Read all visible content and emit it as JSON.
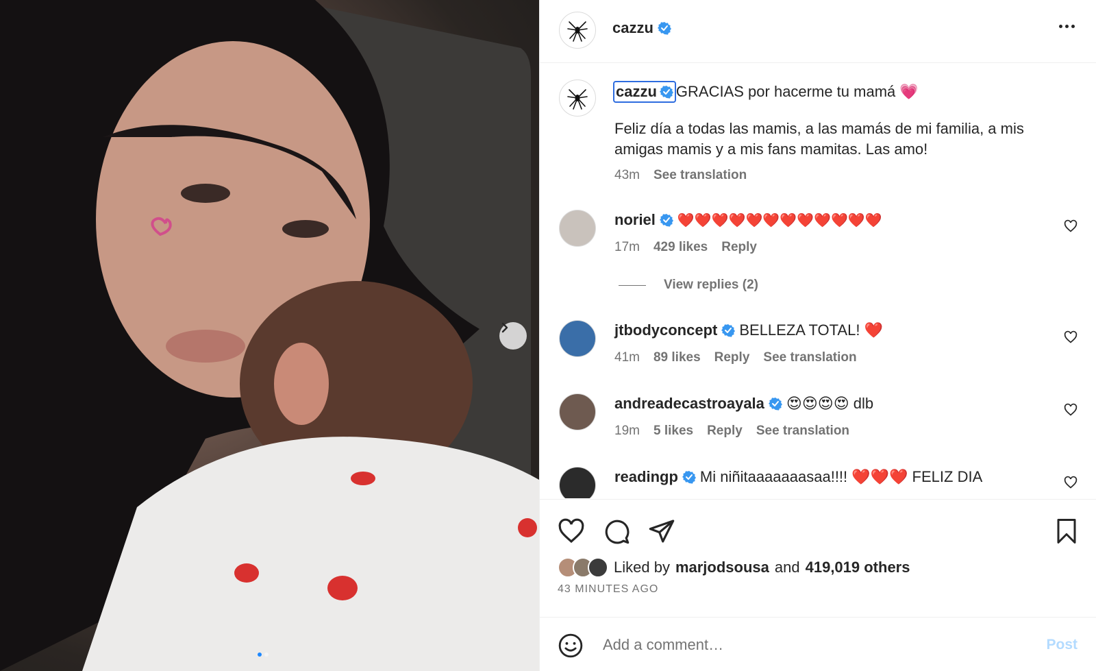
{
  "post": {
    "author": "cazzu",
    "caption_line1": "GRACIAS por hacerme tu mamá 💗",
    "caption_body": "Feliz día a todas las mamis, a las mamás de mi familia, a mis amigas mamis y a mis fans mamitas. Las amo!",
    "caption_time": "43m",
    "see_translation": "See translation"
  },
  "comments": [
    {
      "user": "noriel",
      "text": "❤️❤️❤️❤️❤️❤️❤️❤️❤️❤️❤️❤️",
      "time": "17m",
      "likes": "429 likes",
      "reply": "Reply",
      "avatar_color": "#c9c2bc"
    },
    {
      "user": "jtbodyconcept",
      "text": "BELLEZA TOTAL! ❤️",
      "time": "41m",
      "likes": "89 likes",
      "reply": "Reply",
      "translation": "See translation",
      "avatar_color": "#3a6ea8"
    },
    {
      "user": "andreadecastroayala",
      "text": "😍😍😍😍 dlb",
      "time": "19m",
      "likes": "5 likes",
      "reply": "Reply",
      "translation": "See translation",
      "avatar_color": "#6e5a50"
    },
    {
      "user": "readingp",
      "text": "Mi niñitaaaaaaasaa!!!! ❤️❤️❤️ FELIZ DIA",
      "avatar_color": "#2b2b2b"
    }
  ],
  "view_replies": "View replies (2)",
  "likes": {
    "prefix": "Liked by",
    "user": "marjodsousa",
    "and": "and",
    "count": "419,019 others"
  },
  "posted_ago": "43 MINUTES AGO",
  "comment_box": {
    "placeholder": "Add a comment…",
    "post_label": "Post"
  },
  "colors": {
    "verified": "#3897f0",
    "link_blue": "#b3dbff",
    "muted": "#737373"
  }
}
